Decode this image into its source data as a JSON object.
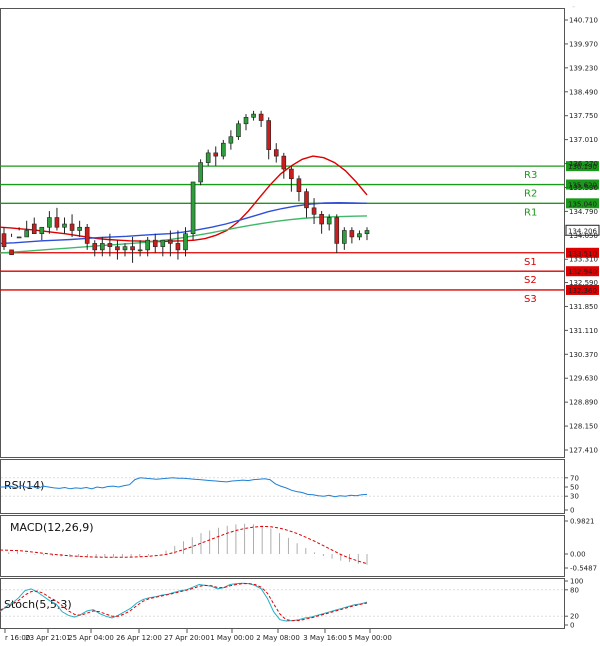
{
  "top_right_label": "-",
  "chart_data": [
    {
      "type": "candlestick",
      "yticks": [
        "140.710",
        "139.970",
        "139.230",
        "138.490",
        "137.750",
        "137.010",
        "136.270",
        "135.530",
        "134.790",
        "134.050",
        "133.310",
        "132.590",
        "131.850",
        "131.110",
        "130.370",
        "129.630",
        "128.890",
        "128.150",
        "127.410"
      ],
      "ylim": [
        127.41,
        141.1
      ],
      "xticks": [
        "r 16:00",
        "23 Apr 21:01",
        "25 Apr 04:00",
        "26 Apr 12:00",
        "27 Apr 20:00",
        "1 May 00:00",
        "2 May 08:00",
        "3 May 16:00",
        "5 May 00:00"
      ],
      "last_price": "134.206",
      "levels": [
        {
          "name": "R3",
          "value": 136.19,
          "label": "136.190",
          "color": "#1a9a1a"
        },
        {
          "name": "R2",
          "value": 135.62,
          "label": "135.620",
          "color": "#1a9a1a"
        },
        {
          "name": "R1",
          "value": 135.04,
          "label": "135.040",
          "color": "#1a9a1a"
        },
        {
          "name": "S1",
          "value": 133.51,
          "label": "133.510",
          "color": "#dd0000"
        },
        {
          "name": "S2",
          "value": 132.94,
          "label": "132.940",
          "color": "#dd0000"
        },
        {
          "name": "S3",
          "value": 132.36,
          "label": "132.360",
          "color": "#dd0000"
        }
      ],
      "candles": [
        [
          134.1,
          134.3,
          133.7,
          133.6
        ],
        [
          133.6,
          134.0,
          133.45,
          134.1
        ],
        [
          134.0,
          134.3,
          134.0,
          134.2
        ],
        [
          134.0,
          134.5,
          134.2,
          134.1
        ],
        [
          134.4,
          134.6,
          134.1,
          134.1
        ],
        [
          134.1,
          134.3,
          134.3,
          133.9
        ],
        [
          134.3,
          134.8,
          134.6,
          134.1
        ],
        [
          134.6,
          134.9,
          134.3,
          134.2
        ],
        [
          134.3,
          134.6,
          134.4,
          134.1
        ],
        [
          134.4,
          134.7,
          134.2,
          134.0
        ],
        [
          134.2,
          134.5,
          134.3,
          134.0
        ],
        [
          134.3,
          134.4,
          133.8,
          133.6
        ],
        [
          133.8,
          133.9,
          133.6,
          133.4
        ],
        [
          133.6,
          134.0,
          133.8,
          133.4
        ],
        [
          133.8,
          134.1,
          133.7,
          133.4
        ],
        [
          133.7,
          133.9,
          133.6,
          133.3
        ],
        [
          133.6,
          133.8,
          133.7,
          133.4
        ],
        [
          133.7,
          134.0,
          133.6,
          133.2
        ],
        [
          133.6,
          133.9,
          133.6,
          133.4
        ],
        [
          133.6,
          134.0,
          133.9,
          133.4
        ],
        [
          133.9,
          134.1,
          133.7,
          133.5
        ],
        [
          133.7,
          133.9,
          133.9,
          133.4
        ],
        [
          133.9,
          134.2,
          133.8,
          133.4
        ],
        [
          133.8,
          134.2,
          133.6,
          133.3
        ],
        [
          133.6,
          134.3,
          134.1,
          133.4
        ],
        [
          134.1,
          135.7,
          135.7,
          133.9
        ],
        [
          135.7,
          136.4,
          136.3,
          135.6
        ],
        [
          136.3,
          136.7,
          136.6,
          136.2
        ],
        [
          136.6,
          136.8,
          136.5,
          136.2
        ],
        [
          136.5,
          137.0,
          136.9,
          136.4
        ],
        [
          136.9,
          137.3,
          137.1,
          136.7
        ],
        [
          137.1,
          137.6,
          137.5,
          137.0
        ],
        [
          137.5,
          137.8,
          137.7,
          137.3
        ],
        [
          137.7,
          137.9,
          137.8,
          137.6
        ],
        [
          137.8,
          137.9,
          137.6,
          137.4
        ],
        [
          137.6,
          137.7,
          136.7,
          136.4
        ],
        [
          136.7,
          136.9,
          136.5,
          136.3
        ],
        [
          136.5,
          136.6,
          136.1,
          135.8
        ],
        [
          136.1,
          136.2,
          135.8,
          135.4
        ],
        [
          135.8,
          135.9,
          135.4,
          135.1
        ],
        [
          135.4,
          135.5,
          134.9,
          134.6
        ],
        [
          134.9,
          135.2,
          134.7,
          134.4
        ],
        [
          134.7,
          134.8,
          134.4,
          134.1
        ],
        [
          134.4,
          134.7,
          134.6,
          134.2
        ],
        [
          134.6,
          134.7,
          133.8,
          133.5
        ],
        [
          133.8,
          134.3,
          134.2,
          133.6
        ],
        [
          134.2,
          134.3,
          134.0,
          133.8
        ],
        [
          134.0,
          134.2,
          134.1,
          133.9
        ],
        [
          134.1,
          134.3,
          134.2,
          133.9
        ]
      ],
      "series": [
        {
          "color": "#dd0000",
          "values": [
            134.3,
            134.28,
            134.25,
            134.22,
            134.18,
            134.14,
            134.1,
            134.05,
            134.0,
            133.95,
            133.92,
            133.9,
            133.88,
            133.87,
            133.86,
            133.86,
            133.87,
            133.88,
            133.9,
            133.95,
            134.05,
            134.2,
            134.45,
            134.8,
            135.2,
            135.6,
            135.95,
            136.2,
            136.4,
            136.5,
            136.45,
            136.3,
            136.05,
            135.7,
            135.3
          ]
        },
        {
          "color": "#2e4fd6",
          "values": [
            133.8,
            133.82,
            133.85,
            133.88,
            133.9,
            133.92,
            133.95,
            133.98,
            134.0,
            134.02,
            134.05,
            134.08,
            134.1,
            134.15,
            134.22,
            134.3,
            134.4,
            134.52,
            134.65,
            134.78,
            134.88,
            134.96,
            135.02,
            135.05,
            135.06,
            135.05,
            135.04
          ]
        },
        {
          "color": "#3fb86a",
          "values": [
            133.5,
            133.53,
            133.56,
            133.59,
            133.62,
            133.65,
            133.68,
            133.71,
            133.74,
            133.77,
            133.8,
            133.83,
            133.87,
            133.92,
            133.98,
            134.05,
            134.12,
            134.2,
            134.28,
            134.35,
            134.42,
            134.48,
            134.53,
            134.57,
            134.6,
            134.62,
            134.63,
            134.64,
            134.65
          ]
        }
      ]
    },
    {
      "type": "line",
      "title": "RSI(14)",
      "yticks": [
        "70",
        "50",
        "30",
        "0"
      ],
      "ylim": [
        0,
        100
      ],
      "series": [
        {
          "color": "#1f7fd6",
          "values": [
            50,
            50,
            52,
            48,
            53,
            49,
            51,
            47,
            52,
            50,
            48,
            47,
            49,
            46,
            48,
            47,
            49,
            46,
            50,
            48,
            51,
            52,
            50,
            53,
            55,
            66,
            70,
            69,
            68,
            67,
            68,
            69,
            70,
            69,
            69,
            68,
            67,
            66,
            65,
            64,
            63,
            62,
            61,
            63,
            64,
            65,
            64,
            66,
            67,
            68,
            66,
            57,
            52,
            48,
            43,
            40,
            38,
            34,
            33,
            31,
            30,
            32,
            29,
            31,
            30,
            32,
            31,
            33,
            34
          ]
        }
      ]
    },
    {
      "type": "bar",
      "title": "MACD(12,26,9)",
      "yticks": [
        "0.9821",
        "0.00",
        "-0.5487"
      ],
      "ylim": [
        -0.5487,
        0.9821
      ],
      "histogram": [
        0.0,
        0.05,
        0.08,
        0.02,
        -0.03,
        -0.05,
        -0.08,
        -0.1,
        -0.12,
        -0.12,
        -0.13,
        -0.14,
        -0.14,
        -0.14,
        -0.13,
        -0.12,
        -0.1,
        -0.06,
        0.0,
        0.1,
        0.24,
        0.38,
        0.5,
        0.62,
        0.7,
        0.78,
        0.84,
        0.88,
        0.9,
        0.88,
        0.84,
        0.76,
        0.62,
        0.48,
        0.32,
        0.18,
        0.05,
        -0.08,
        -0.18,
        -0.26,
        -0.32,
        -0.38,
        -0.42
      ],
      "signal": {
        "color": "#dd0000",
        "values": [
          0.12,
          0.11,
          0.1,
          0.08,
          0.05,
          0.02,
          -0.01,
          -0.04,
          -0.07,
          -0.09,
          -0.11,
          -0.12,
          -0.13,
          -0.13,
          -0.13,
          -0.12,
          -0.11,
          -0.09,
          -0.06,
          -0.02,
          0.05,
          0.13,
          0.22,
          0.32,
          0.42,
          0.52,
          0.62,
          0.7,
          0.76,
          0.8,
          0.82,
          0.81,
          0.77,
          0.7,
          0.61,
          0.5,
          0.38,
          0.25,
          0.12,
          -0.02,
          -0.16,
          -0.28,
          -0.38
        ]
      }
    },
    {
      "type": "line",
      "title": "Stoch(5,5,3)",
      "yticks": [
        "100",
        "80",
        "20",
        "0"
      ],
      "ylim": [
        0,
        100
      ],
      "series": [
        {
          "color": "#20b0c8",
          "values": [
            30,
            42,
            50,
            62,
            78,
            82,
            75,
            65,
            55,
            48,
            30,
            22,
            18,
            24,
            32,
            35,
            26,
            20,
            16,
            22,
            30,
            38,
            50,
            58,
            62,
            64,
            68,
            70,
            74,
            78,
            80,
            86,
            92,
            90,
            88,
            82,
            85,
            92,
            94,
            95,
            94,
            90,
            82,
            60,
            30,
            12,
            9,
            10,
            12,
            16,
            18,
            22,
            26,
            30,
            34,
            38,
            42,
            46,
            48,
            52
          ]
        },
        {
          "color": "#dd0000",
          "values": [
            34,
            40,
            47,
            56,
            68,
            76,
            77,
            72,
            62,
            55,
            44,
            32,
            24,
            22,
            27,
            32,
            30,
            25,
            20,
            20,
            25,
            33,
            44,
            54,
            60,
            63,
            66,
            69,
            72,
            76,
            79,
            83,
            88,
            90,
            89,
            85,
            85,
            89,
            92,
            94,
            94,
            92,
            86,
            72,
            48,
            25,
            12,
            10,
            10,
            13,
            16,
            20,
            24,
            28,
            32,
            36,
            40,
            44,
            47,
            50
          ]
        }
      ]
    }
  ]
}
